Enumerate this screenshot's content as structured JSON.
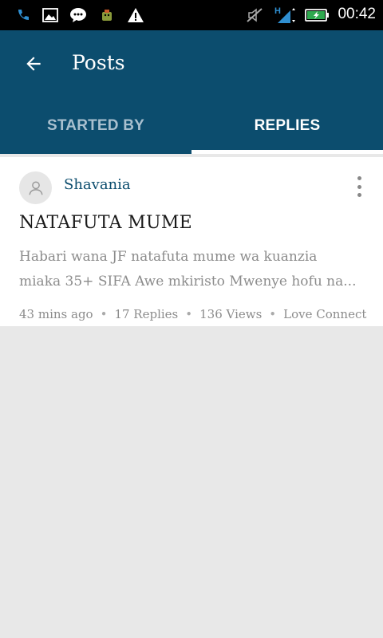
{
  "status_bar": {
    "time": "00:42",
    "icons": [
      "phone-call-icon",
      "image-icon",
      "chat-bubble-icon",
      "android-debug-icon",
      "warning-icon",
      "muted-volume-icon",
      "hspa-signal-icon",
      "battery-charging-icon"
    ],
    "network_label": "H"
  },
  "app_bar": {
    "title": "Posts",
    "back_icon": "back-arrow-icon"
  },
  "tabs": [
    {
      "label": "STARTED BY",
      "active": false
    },
    {
      "label": "REPLIES",
      "active": true
    }
  ],
  "post": {
    "author": "Shavania",
    "title": "NATAFUTA MUME",
    "excerpt_lines": [
      "Habari wana JF natafuta mume wa kuanzia",
      "miaka 35+ SIFA Awe mkiristo Mwenye hofu na..."
    ],
    "meta": {
      "time_ago": "43 mins ago",
      "replies": "17 Replies",
      "views": "136 Views",
      "forum": "Love Connect"
    }
  },
  "colors": {
    "primary": "#0c4d6e",
    "status_bar": "#000000",
    "background": "#e8e8e8",
    "card": "#ffffff",
    "muted_text": "#8c8c8c"
  }
}
